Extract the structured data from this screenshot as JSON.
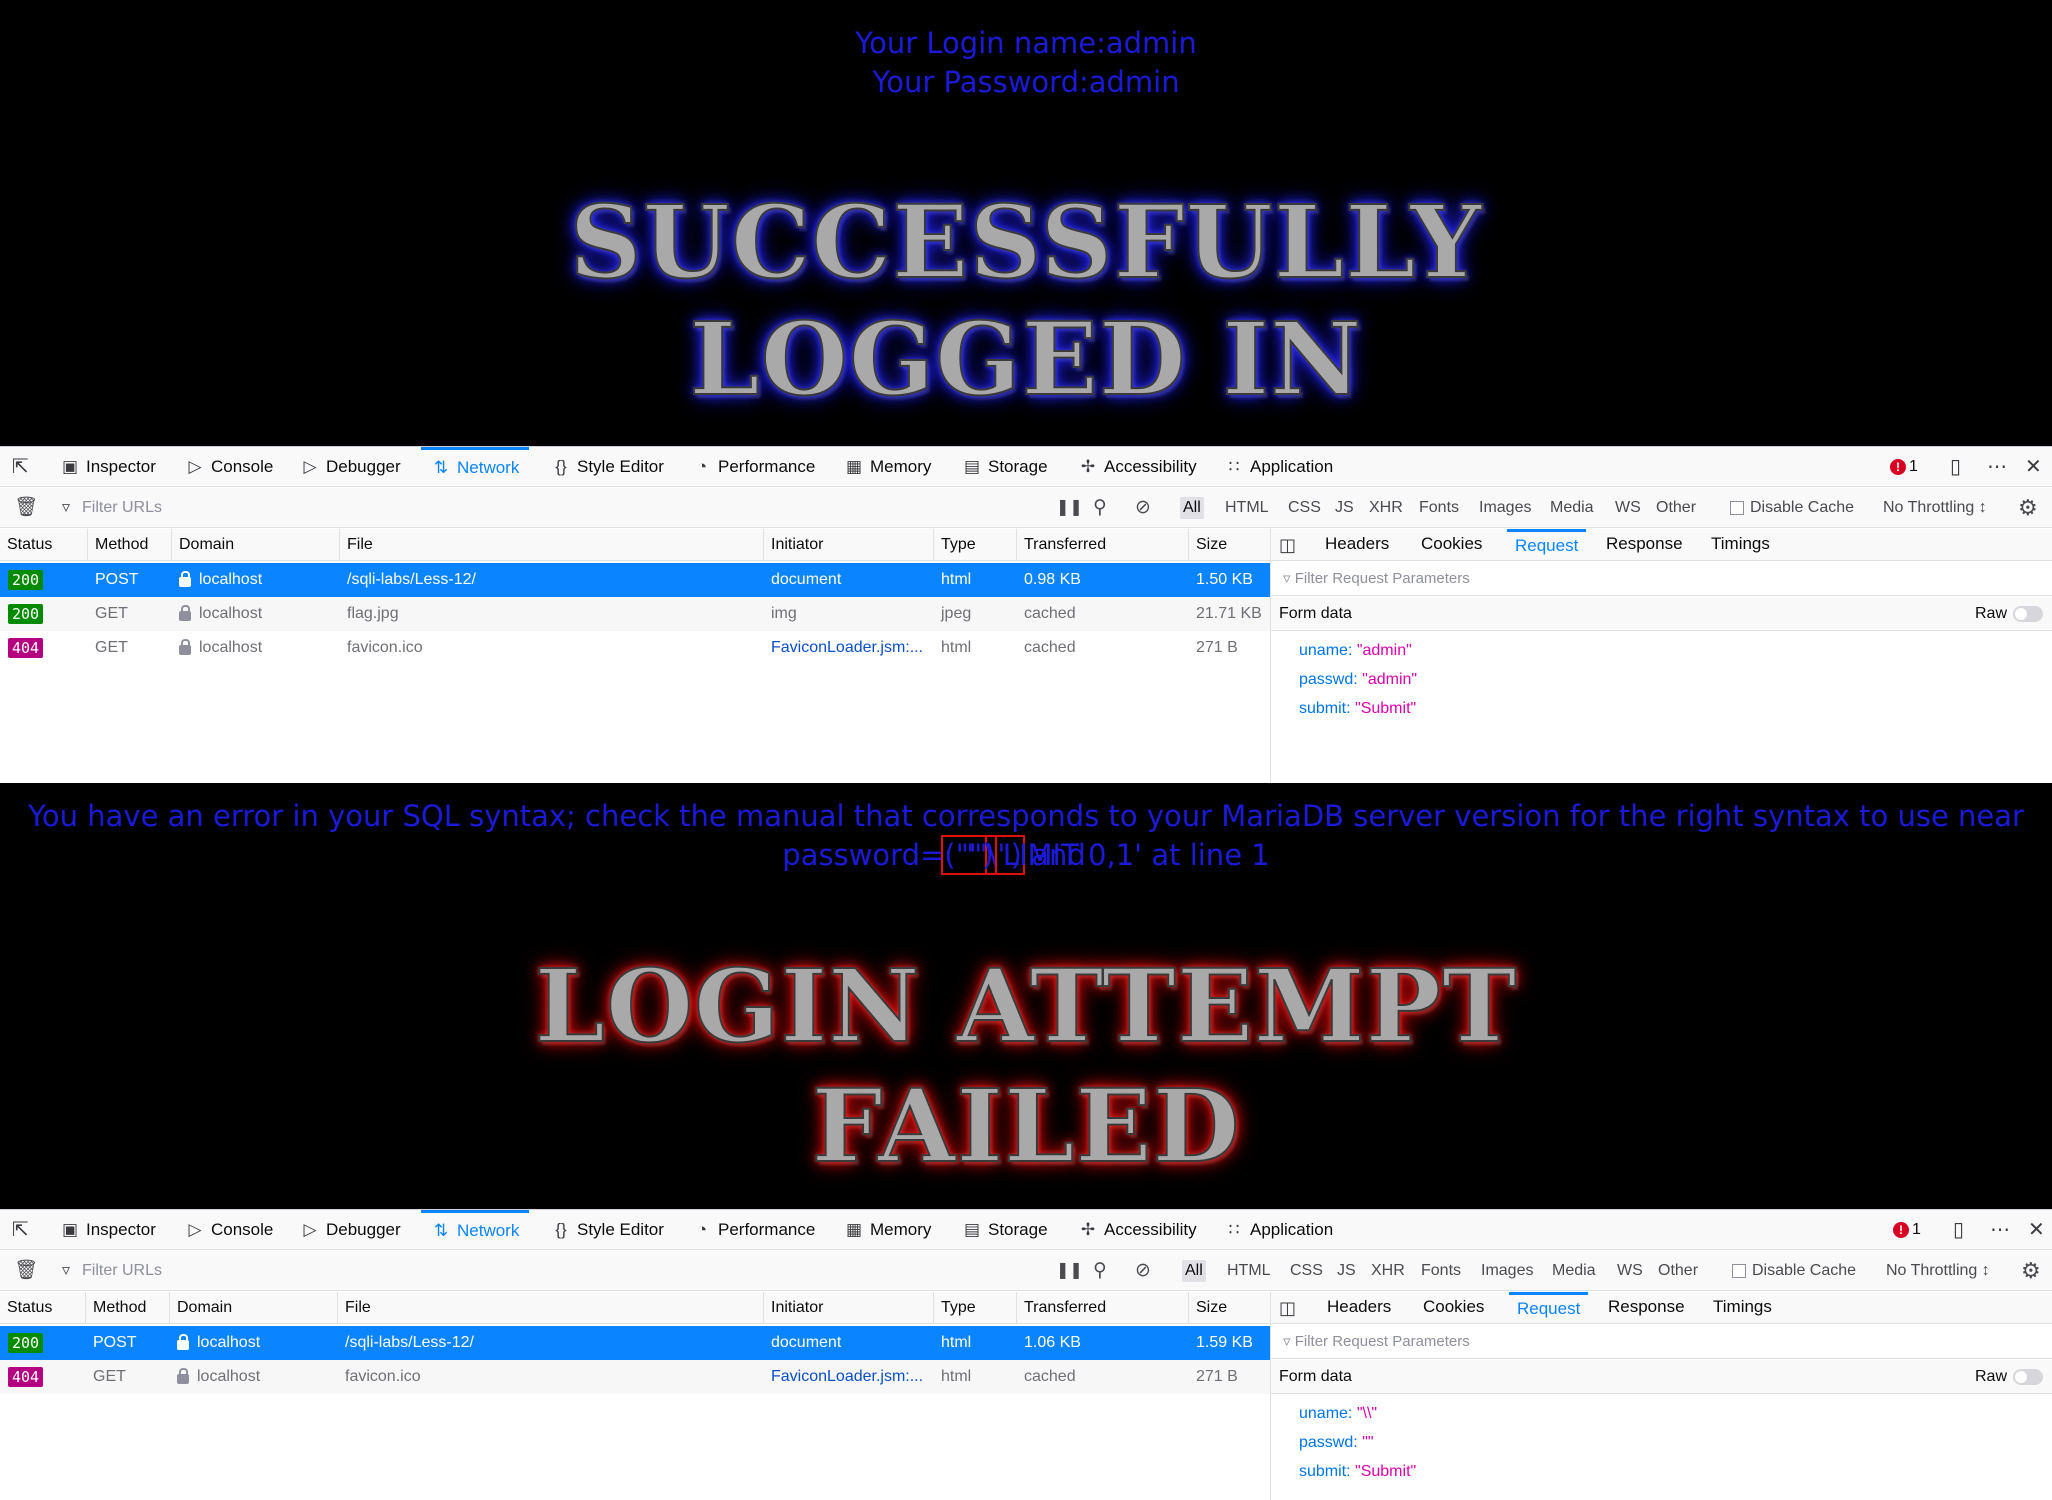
{
  "top": {
    "login_name": "Your Login name:admin",
    "password": "Your Password:admin",
    "banner_line1": "SUCCESSFULLY",
    "banner_line2": "LOGGED IN"
  },
  "bottom": {
    "error_line1_pre": "You have an error in your SQL syntax; check the manual that corresponds to your MariaDB server version for the right syntax to use near '\"",
    "error_line1_hl": "\\\")",
    "error_line1_post": " and",
    "error_line2_pre": "password=",
    "error_line2_hl": "(\"\")",
    "error_line2_post": " LIMIT 0,1' at line 1",
    "banner_line1": "LOGIN ATTEMPT",
    "banner_line2": "FAILED"
  },
  "devtools_tabs": [
    "Inspector",
    "Console",
    "Debugger",
    "Network",
    "Style Editor",
    "Performance",
    "Memory",
    "Storage",
    "Accessibility",
    "Application"
  ],
  "error_count": "1",
  "toolbar": {
    "filter_placeholder": "Filter URLs",
    "types": [
      "All",
      "HTML",
      "CSS",
      "JS",
      "XHR",
      "Fonts",
      "Images",
      "Media",
      "WS",
      "Other"
    ],
    "disable_cache": "Disable Cache",
    "throttling": "No Throttling ↕"
  },
  "columns": [
    "Status",
    "Method",
    "Domain",
    "File",
    "Initiator",
    "Type",
    "Transferred",
    "Size"
  ],
  "side_tabs": [
    "Headers",
    "Cookies",
    "Request",
    "Response",
    "Timings"
  ],
  "side_filter_placeholder": "Filter Request Parameters",
  "form_data_label": "Form data",
  "raw_label": "Raw",
  "panel1": {
    "rows": [
      {
        "status": "200",
        "method": "POST",
        "domain": "localhost",
        "file": "/sqli-labs/Less-12/",
        "initiator": "document",
        "type": "html",
        "transferred": "0.98 KB",
        "size": "1.50 KB"
      },
      {
        "status": "200",
        "method": "GET",
        "domain": "localhost",
        "file": "flag.jpg",
        "initiator": "img",
        "type": "jpeg",
        "transferred": "cached",
        "size": "21.71 KB"
      },
      {
        "status": "404",
        "method": "GET",
        "domain": "localhost",
        "file": "favicon.ico",
        "initiator": "FaviconLoader.jsm:...",
        "type": "html",
        "transferred": "cached",
        "size": "271 B"
      }
    ],
    "params": [
      {
        "key": "uname:",
        "value": "\"admin\""
      },
      {
        "key": "passwd:",
        "value": "\"admin\""
      },
      {
        "key": "submit:",
        "value": "\"Submit\""
      }
    ]
  },
  "panel2": {
    "rows": [
      {
        "status": "200",
        "method": "POST",
        "domain": "localhost",
        "file": "/sqli-labs/Less-12/",
        "initiator": "document",
        "type": "html",
        "transferred": "1.06 KB",
        "size": "1.59 KB"
      },
      {
        "status": "404",
        "method": "GET",
        "domain": "localhost",
        "file": "favicon.ico",
        "initiator": "FaviconLoader.jsm:...",
        "type": "html",
        "transferred": "cached",
        "size": "271 B"
      }
    ],
    "params": [
      {
        "key": "uname:",
        "value": "\"\\\\\""
      },
      {
        "key": "passwd:",
        "value": "\"\""
      },
      {
        "key": "submit:",
        "value": "\"Submit\""
      }
    ]
  },
  "colors": {
    "page_text": "#1a1ad8",
    "accent": "#0a84ff",
    "status_200": "#058b00",
    "status_404": "#b5007f",
    "param_key": "#0074e8",
    "param_value": "#dd00a9",
    "highlight_box": "#e01010"
  },
  "icons": [
    "pick-element-icon",
    "inspector-icon",
    "console-icon",
    "debugger-icon",
    "network-icon",
    "style-editor-icon",
    "performance-icon",
    "memory-icon",
    "storage-icon",
    "accessibility-icon",
    "application-icon",
    "error-icon",
    "responsive-icon",
    "more-icon",
    "close-icon",
    "trash-icon",
    "filter-icon",
    "pause-icon",
    "search-icon",
    "block-icon",
    "settings-icon",
    "lock-icon",
    "panel-toggle-icon"
  ]
}
